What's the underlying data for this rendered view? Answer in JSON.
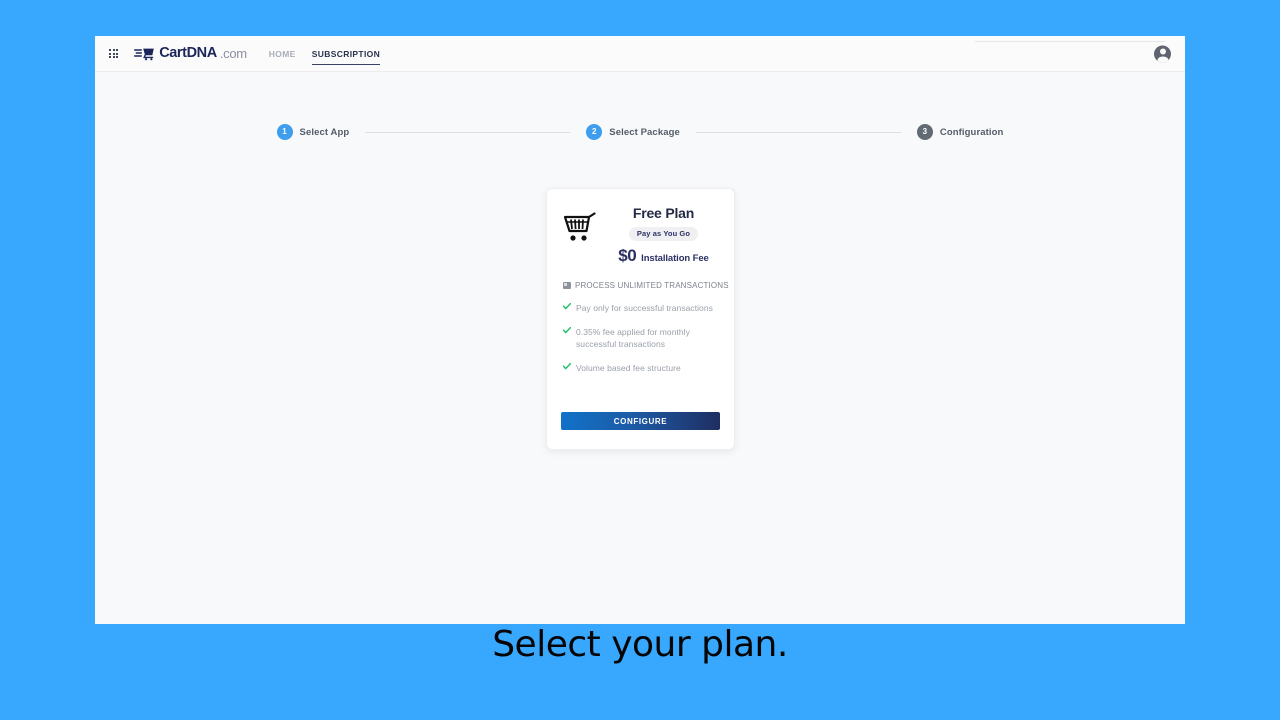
{
  "page": {
    "background_color": "#38a7fe",
    "caption": "Select your plan."
  },
  "header": {
    "apps_icon": "apps-grid-icon",
    "brand": {
      "logo_icon": "cart-speed-logo-icon",
      "name": "CartDNA",
      "tld": ".com"
    },
    "nav": [
      {
        "label": "HOME",
        "active": false
      },
      {
        "label": "SUBSCRIPTION",
        "active": true
      }
    ],
    "avatar_icon": "user-avatar-icon"
  },
  "stepper": {
    "steps": [
      {
        "number": "1",
        "label": "Select App",
        "state": "active"
      },
      {
        "number": "2",
        "label": "Select Package",
        "state": "active"
      },
      {
        "number": "3",
        "label": "Configuration",
        "state": "inactive"
      }
    ],
    "active_color": "#3e9ded",
    "inactive_color": "#636a74"
  },
  "plan_card": {
    "illustration_icon": "shopping-cart-icon",
    "title": "Free Plan",
    "badge": "Pay as You Go",
    "price": "$0",
    "price_note": "Installation Fee",
    "tagline_icon": "screen-icon",
    "tagline": "PROCESS UNLIMITED TRANSACTIONS",
    "features": [
      {
        "icon": "check-icon",
        "text": "Pay only for successful transactions"
      },
      {
        "icon": "check-icon",
        "text": "0.35% fee applied for monthly successful transactions"
      },
      {
        "icon": "check-icon",
        "text": "Volume based fee structure"
      }
    ],
    "check_color": "#25c16f",
    "configure_label": "CONFIGURE",
    "configure_gradient_from": "#1172c8",
    "configure_gradient_to": "#1e2e61"
  }
}
